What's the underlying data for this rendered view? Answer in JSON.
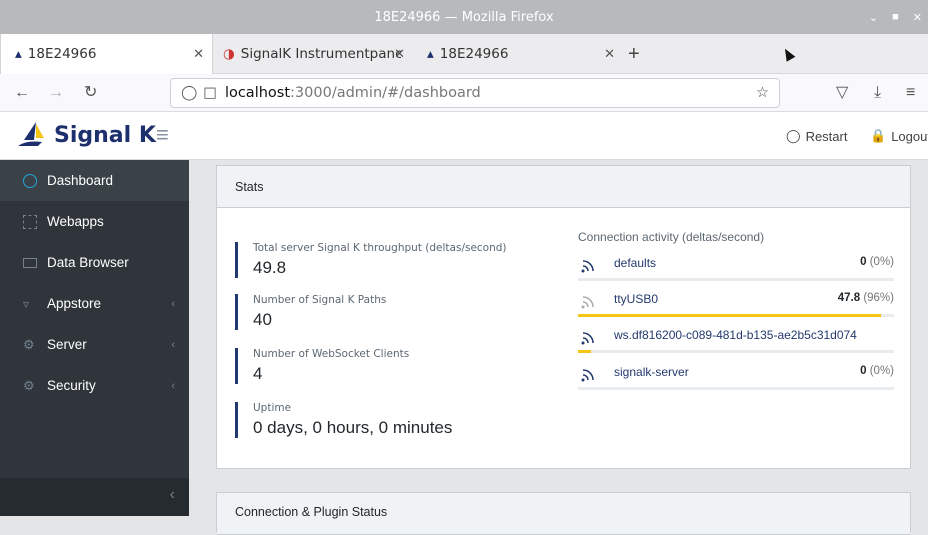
{
  "window": {
    "title": "18E24966 — Mozilla Firefox"
  },
  "tabs": [
    {
      "label": "18E24966"
    },
    {
      "label": "SignalK Instrumentpane"
    },
    {
      "label": "18E24966"
    }
  ],
  "navbar": {
    "url_host": "localhost",
    "url_path": ":3000/admin/#/dashboard"
  },
  "app": {
    "brand": "Signal K",
    "restart_label": "Restart",
    "logout_label": "Logout"
  },
  "sidebar": {
    "items": [
      {
        "label": "Dashboard",
        "icon": "speedometer-icon",
        "active": true
      },
      {
        "label": "Webapps",
        "icon": "grid-icon"
      },
      {
        "label": "Data Browser",
        "icon": "folder-icon"
      },
      {
        "label": "Appstore",
        "icon": "cart-icon",
        "chevron": "‹"
      },
      {
        "label": "Server",
        "icon": "gear-icon",
        "chevron": "‹"
      },
      {
        "label": "Security",
        "icon": "gear-icon",
        "chevron": "‹"
      }
    ],
    "collapse": "‹"
  },
  "stats": {
    "title": "Stats",
    "callouts": [
      {
        "label": "Total server Signal K throughput (deltas/second)",
        "value": "49.8"
      },
      {
        "label": "Number of Signal K Paths",
        "value": "40"
      },
      {
        "label": "Number of WebSocket Clients",
        "value": "4"
      },
      {
        "label": "Uptime",
        "value": "0 days, 0 hours, 0 minutes"
      }
    ],
    "connection_title": "Connection activity (deltas/second)",
    "connections": [
      {
        "name": "defaults",
        "rate": "0",
        "pct": "(0%)",
        "level": 0
      },
      {
        "name": "ttyUSB0",
        "rate": "47.8",
        "pct": "(96%)",
        "level": 0.96
      },
      {
        "name": "ws.df816200-c089-481d-b135-ae2b5c31d074",
        "rate": "",
        "pct": "",
        "level": 0.04
      },
      {
        "name": "signalk-server",
        "rate": "0",
        "pct": "(0%)",
        "level": 0
      }
    ]
  },
  "plugins_card": {
    "title": "Connection & Plugin Status"
  },
  "colors": {
    "brand": "#1e2f6e",
    "sidebar": "#2f353a",
    "bar": "#f5c518"
  }
}
